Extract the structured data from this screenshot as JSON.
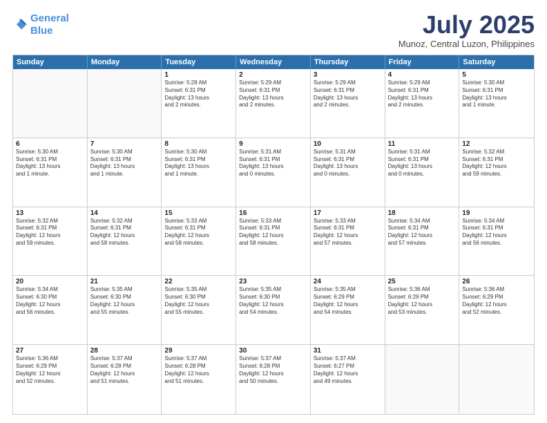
{
  "logo": {
    "line1": "General",
    "line2": "Blue"
  },
  "title": "July 2025",
  "location": "Munoz, Central Luzon, Philippines",
  "header_days": [
    "Sunday",
    "Monday",
    "Tuesday",
    "Wednesday",
    "Thursday",
    "Friday",
    "Saturday"
  ],
  "weeks": [
    [
      {
        "day": "",
        "content": ""
      },
      {
        "day": "",
        "content": ""
      },
      {
        "day": "1",
        "content": "Sunrise: 5:28 AM\nSunset: 6:31 PM\nDaylight: 13 hours\nand 2 minutes."
      },
      {
        "day": "2",
        "content": "Sunrise: 5:29 AM\nSunset: 6:31 PM\nDaylight: 13 hours\nand 2 minutes."
      },
      {
        "day": "3",
        "content": "Sunrise: 5:29 AM\nSunset: 6:31 PM\nDaylight: 13 hours\nand 2 minutes."
      },
      {
        "day": "4",
        "content": "Sunrise: 5:29 AM\nSunset: 6:31 PM\nDaylight: 13 hours\nand 2 minutes."
      },
      {
        "day": "5",
        "content": "Sunrise: 5:30 AM\nSunset: 6:31 PM\nDaylight: 13 hours\nand 1 minute."
      }
    ],
    [
      {
        "day": "6",
        "content": "Sunrise: 5:30 AM\nSunset: 6:31 PM\nDaylight: 13 hours\nand 1 minute."
      },
      {
        "day": "7",
        "content": "Sunrise: 5:30 AM\nSunset: 6:31 PM\nDaylight: 13 hours\nand 1 minute."
      },
      {
        "day": "8",
        "content": "Sunrise: 5:30 AM\nSunset: 6:31 PM\nDaylight: 13 hours\nand 1 minute."
      },
      {
        "day": "9",
        "content": "Sunrise: 5:31 AM\nSunset: 6:31 PM\nDaylight: 13 hours\nand 0 minutes."
      },
      {
        "day": "10",
        "content": "Sunrise: 5:31 AM\nSunset: 6:31 PM\nDaylight: 13 hours\nand 0 minutes."
      },
      {
        "day": "11",
        "content": "Sunrise: 5:31 AM\nSunset: 6:31 PM\nDaylight: 13 hours\nand 0 minutes."
      },
      {
        "day": "12",
        "content": "Sunrise: 5:32 AM\nSunset: 6:31 PM\nDaylight: 12 hours\nand 59 minutes."
      }
    ],
    [
      {
        "day": "13",
        "content": "Sunrise: 5:32 AM\nSunset: 6:31 PM\nDaylight: 12 hours\nand 59 minutes."
      },
      {
        "day": "14",
        "content": "Sunrise: 5:32 AM\nSunset: 6:31 PM\nDaylight: 12 hours\nand 58 minutes."
      },
      {
        "day": "15",
        "content": "Sunrise: 5:33 AM\nSunset: 6:31 PM\nDaylight: 12 hours\nand 58 minutes."
      },
      {
        "day": "16",
        "content": "Sunrise: 5:33 AM\nSunset: 6:31 PM\nDaylight: 12 hours\nand 58 minutes."
      },
      {
        "day": "17",
        "content": "Sunrise: 5:33 AM\nSunset: 6:31 PM\nDaylight: 12 hours\nand 57 minutes."
      },
      {
        "day": "18",
        "content": "Sunrise: 5:34 AM\nSunset: 6:31 PM\nDaylight: 12 hours\nand 57 minutes."
      },
      {
        "day": "19",
        "content": "Sunrise: 5:34 AM\nSunset: 6:31 PM\nDaylight: 12 hours\nand 56 minutes."
      }
    ],
    [
      {
        "day": "20",
        "content": "Sunrise: 5:34 AM\nSunset: 6:30 PM\nDaylight: 12 hours\nand 56 minutes."
      },
      {
        "day": "21",
        "content": "Sunrise: 5:35 AM\nSunset: 6:30 PM\nDaylight: 12 hours\nand 55 minutes."
      },
      {
        "day": "22",
        "content": "Sunrise: 5:35 AM\nSunset: 6:30 PM\nDaylight: 12 hours\nand 55 minutes."
      },
      {
        "day": "23",
        "content": "Sunrise: 5:35 AM\nSunset: 6:30 PM\nDaylight: 12 hours\nand 54 minutes."
      },
      {
        "day": "24",
        "content": "Sunrise: 5:35 AM\nSunset: 6:29 PM\nDaylight: 12 hours\nand 54 minutes."
      },
      {
        "day": "25",
        "content": "Sunrise: 5:36 AM\nSunset: 6:29 PM\nDaylight: 12 hours\nand 53 minutes."
      },
      {
        "day": "26",
        "content": "Sunrise: 5:36 AM\nSunset: 6:29 PM\nDaylight: 12 hours\nand 52 minutes."
      }
    ],
    [
      {
        "day": "27",
        "content": "Sunrise: 5:36 AM\nSunset: 6:29 PM\nDaylight: 12 hours\nand 52 minutes."
      },
      {
        "day": "28",
        "content": "Sunrise: 5:37 AM\nSunset: 6:28 PM\nDaylight: 12 hours\nand 51 minutes."
      },
      {
        "day": "29",
        "content": "Sunrise: 5:37 AM\nSunset: 6:28 PM\nDaylight: 12 hours\nand 51 minutes."
      },
      {
        "day": "30",
        "content": "Sunrise: 5:37 AM\nSunset: 6:28 PM\nDaylight: 12 hours\nand 50 minutes."
      },
      {
        "day": "31",
        "content": "Sunrise: 5:37 AM\nSunset: 6:27 PM\nDaylight: 12 hours\nand 49 minutes."
      },
      {
        "day": "",
        "content": ""
      },
      {
        "day": "",
        "content": ""
      }
    ]
  ]
}
